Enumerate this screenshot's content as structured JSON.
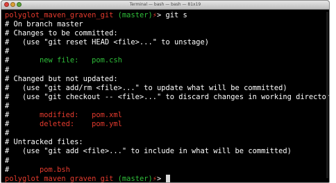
{
  "window": {
    "title": "Terminal — bash — bash — 81x19"
  },
  "prompt": {
    "dir": "polyglot_maven_graven_git",
    "branch": "(master)",
    "suffix": "⚡",
    "symbol": ">",
    "command": "git s"
  },
  "status": {
    "branch_line": "# On branch master",
    "staged_header": "# Changes to be committed:",
    "staged_hint": "#   (use \"git reset HEAD <file>...\" to unstage)",
    "blank": "#",
    "staged_file_label": "new file:",
    "staged_file": "pom.csh",
    "changed_header": "# Changed but not updated:",
    "changed_hint1": "#   (use \"git add/rm <file>...\" to update what will be committed)",
    "changed_hint2": "#   (use \"git checkout -- <file>...\" to discard changes in working directory)",
    "modified_label": "modified:",
    "modified_file": "pom.xml",
    "deleted_label": "deleted:",
    "deleted_file": "pom.yml",
    "untracked_header": "# Untracked files:",
    "untracked_hint": "#   (use \"git add <file>...\" to include in what will be committed)",
    "untracked_file": "pom.bsh"
  },
  "colors": {
    "red": "#e63b2e",
    "green": "#2fbf3a",
    "background": "#000000"
  }
}
